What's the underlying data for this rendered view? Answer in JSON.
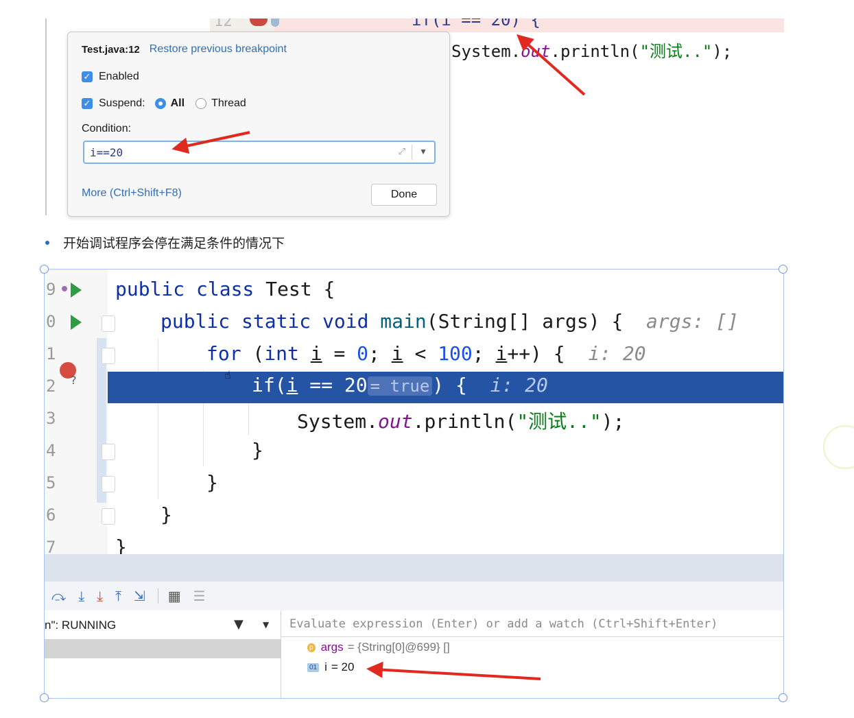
{
  "top_editor": {
    "line_number": "12",
    "cut_code": "if(i == 20) {",
    "sys_prefix": "System.",
    "sys_out": "out",
    "sys_mid": ".println(",
    "sys_str": "\"测试..\"",
    "sys_end": ");"
  },
  "breakpoint_popup": {
    "location": "Test.java:12",
    "restore_link": "Restore previous breakpoint",
    "enabled_label": "Enabled",
    "suspend_label": "Suspend:",
    "all_label": "All",
    "thread_label": "Thread",
    "condition_label": "Condition:",
    "condition_value": "i==20",
    "more_link": "More (Ctrl+Shift+F8)",
    "done_label": "Done"
  },
  "bullet_text": "开始调试程序会停在满足条件的情况下",
  "editor": {
    "line_numbers": [
      "9",
      "0",
      "1",
      "2",
      "3",
      "4",
      "5",
      "6",
      "7"
    ],
    "hint_args": "args: []",
    "hint_i": "i: 20",
    "true_hint": "= true"
  },
  "debugger": {
    "thread_status": "n\": RUNNING",
    "eval_placeholder": "Evaluate expression (Enter) or add a watch (Ctrl+Shift+Enter)",
    "variables": [
      {
        "badge": "p",
        "name": "args",
        "value": "= {String[0]@699} []"
      },
      {
        "badge": "01",
        "name": "i",
        "value": "= 20"
      }
    ]
  },
  "colors": {
    "current_line": "#2554a4",
    "keyword": "#0d30a8",
    "annotation_arrow": "#e02a1f",
    "accent": "#3d8ee6"
  }
}
